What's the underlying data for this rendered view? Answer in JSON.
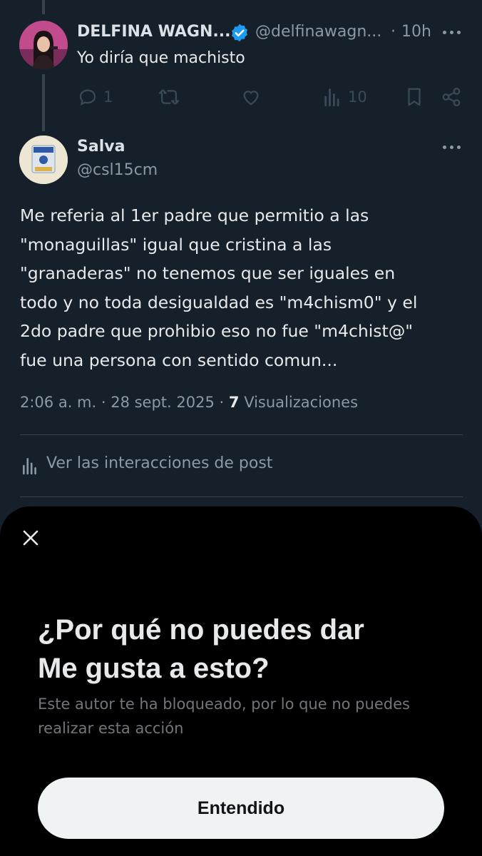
{
  "reply_parent": {
    "display_name": "DELFINA WAGN...",
    "handle": "@delfinawagn...",
    "separator": "·",
    "time": "10h",
    "text": "Yo diría que machisto",
    "replies": "1",
    "views": "10",
    "verified": true
  },
  "post": {
    "display_name": "Salva",
    "handle": "@csl15cm",
    "text_lines": [
      "Me referia al 1er padre que permitio a las",
      "\"monaguillas\" igual que cristina a las",
      "\"granaderas\" no tenemos que ser iguales en",
      "todo y no toda desigualdad es \"m4chism0\" y el",
      "2do padre que prohibio eso no fue \"m4chist@\"",
      "fue una persona con sentido comun..."
    ],
    "meta_time": "2:06 a. m. · 28 sept. 2025 ·",
    "views_count": "7",
    "views_label": "Visualizaciones",
    "interactions_link": "Ver las interacciones de post"
  },
  "sheet": {
    "title_line1": "¿Por qué no puedes dar",
    "title_line2": "Me gusta a esto?",
    "body_line1": "Este autor te ha bloqueado, por lo que no puedes",
    "body_line2": "realizar esta acción",
    "button_label": "Entendido"
  },
  "colors": {
    "background": "#15202b",
    "sheet_background": "#000000",
    "verified_badge": "#1d9bf0",
    "button_background": "#eff3f4"
  },
  "icons": [
    "reply-icon",
    "retweet-icon",
    "like-icon",
    "views-icon",
    "bookmark-icon",
    "share-icon",
    "more-icon",
    "close-icon",
    "verified-icon",
    "analytics-icon"
  ]
}
